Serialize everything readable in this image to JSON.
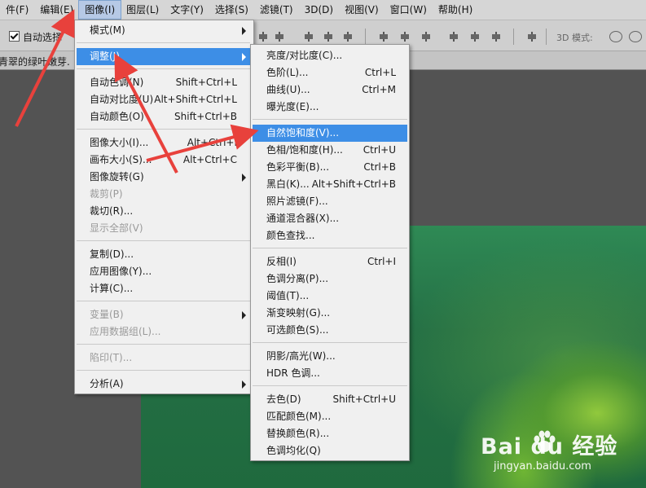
{
  "menubar": [
    "件(F)",
    "编辑(E)",
    "图像(I)",
    "图层(L)",
    "文字(Y)",
    "选择(S)",
    "滤镜(T)",
    "3D(D)",
    "视图(V)",
    "窗口(W)",
    "帮助(H)"
  ],
  "options": {
    "auto_select": "自动选择",
    "mode3d": "3D 模式:"
  },
  "doc_tab": "青翠的绿叶嫩芽.",
  "image_menu": [
    {
      "label": "模式(M)",
      "arrow": true
    },
    {
      "sep": true
    },
    {
      "label": "调整(J)",
      "arrow": true,
      "hl": true
    },
    {
      "sep": true
    },
    {
      "label": "自动色调(N)",
      "shortcut": "Shift+Ctrl+L"
    },
    {
      "label": "自动对比度(U)",
      "shortcut": "Alt+Shift+Ctrl+L"
    },
    {
      "label": "自动颜色(O)",
      "shortcut": "Shift+Ctrl+B"
    },
    {
      "sep": true
    },
    {
      "label": "图像大小(I)...",
      "shortcut": "Alt+Ctrl+I"
    },
    {
      "label": "画布大小(S)...",
      "shortcut": "Alt+Ctrl+C"
    },
    {
      "label": "图像旋转(G)",
      "arrow": true
    },
    {
      "label": "裁剪(P)",
      "disabled": true
    },
    {
      "label": "裁切(R)..."
    },
    {
      "label": "显示全部(V)",
      "disabled": true
    },
    {
      "sep": true
    },
    {
      "label": "复制(D)..."
    },
    {
      "label": "应用图像(Y)..."
    },
    {
      "label": "计算(C)..."
    },
    {
      "sep": true
    },
    {
      "label": "变量(B)",
      "arrow": true,
      "disabled": true
    },
    {
      "label": "应用数据组(L)...",
      "disabled": true
    },
    {
      "sep": true
    },
    {
      "label": "陷印(T)...",
      "disabled": true
    },
    {
      "sep": true
    },
    {
      "label": "分析(A)",
      "arrow": true
    }
  ],
  "adjust_menu": [
    {
      "label": "亮度/对比度(C)..."
    },
    {
      "label": "色阶(L)...",
      "shortcut": "Ctrl+L"
    },
    {
      "label": "曲线(U)...",
      "shortcut": "Ctrl+M"
    },
    {
      "label": "曝光度(E)..."
    },
    {
      "sep": true
    },
    {
      "label": "自然饱和度(V)...",
      "hl": true
    },
    {
      "label": "色相/饱和度(H)...",
      "shortcut": "Ctrl+U"
    },
    {
      "label": "色彩平衡(B)...",
      "shortcut": "Ctrl+B"
    },
    {
      "label": "黑白(K)...",
      "shortcut": "Alt+Shift+Ctrl+B"
    },
    {
      "label": "照片滤镜(F)..."
    },
    {
      "label": "通道混合器(X)..."
    },
    {
      "label": "颜色查找..."
    },
    {
      "sep": true
    },
    {
      "label": "反相(I)",
      "shortcut": "Ctrl+I"
    },
    {
      "label": "色调分离(P)..."
    },
    {
      "label": "阈值(T)..."
    },
    {
      "label": "渐变映射(G)..."
    },
    {
      "label": "可选颜色(S)..."
    },
    {
      "sep": true
    },
    {
      "label": "阴影/高光(W)..."
    },
    {
      "label": "HDR 色调..."
    },
    {
      "sep": true
    },
    {
      "label": "去色(D)",
      "shortcut": "Shift+Ctrl+U"
    },
    {
      "label": "匹配颜色(M)..."
    },
    {
      "label": "替换颜色(R)..."
    },
    {
      "label": "色调均化(Q)"
    }
  ],
  "watermark": {
    "brand": "Bai  du 经验",
    "url": "jingyan.baidu.com"
  },
  "colors": {
    "highlight": "#3d8ee6",
    "arrow": "#e8413c"
  }
}
